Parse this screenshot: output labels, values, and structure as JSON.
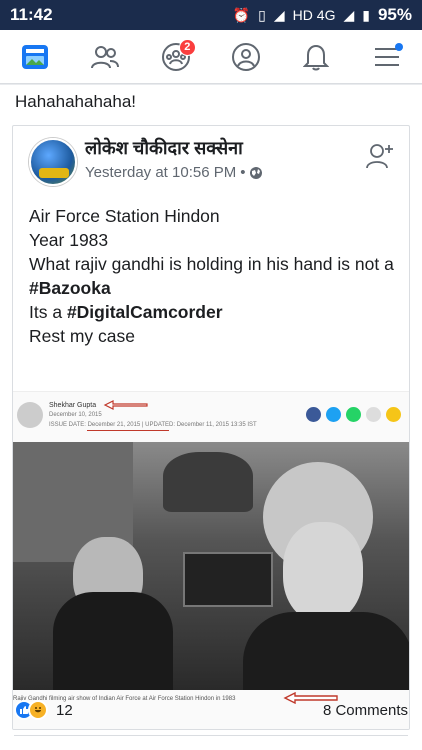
{
  "status": {
    "time": "11:42",
    "network": "HD 4G",
    "battery": "95%"
  },
  "nav": {
    "notifications_badge": "2"
  },
  "post": {
    "text": "Hahahahahaha!"
  },
  "shared": {
    "author": "लोकेश चौकीदार सक्सेना",
    "timestamp": "Yesterday at 10:56 PM",
    "lines": {
      "l1": "Air Force Station Hindon",
      "l2": "Year 1983",
      "l3": "What rajiv gandhi is holding in his hand is not a ",
      "l3_tag": "#Bazooka",
      "l4": "Its a ",
      "l4_tag": "#DigitalCamcorder",
      "l5": "Rest my case"
    },
    "article": {
      "author": "Shekhar Gupta",
      "date": "December 10, 2015",
      "issue": "ISSUE DATE: December 21, 2015 | UPDATED: December 11, 2015 13:35 IST",
      "caption": "Rajiv Gandhi filming air show of Indian Air Force at Air Force Station Hindon in 1983"
    }
  },
  "footer": {
    "reaction_count": "12",
    "comments": "8 Comments"
  },
  "colors": {
    "statusbar": "#1b2c4c",
    "accent": "#1877f2",
    "badge": "#fa3e3e"
  }
}
